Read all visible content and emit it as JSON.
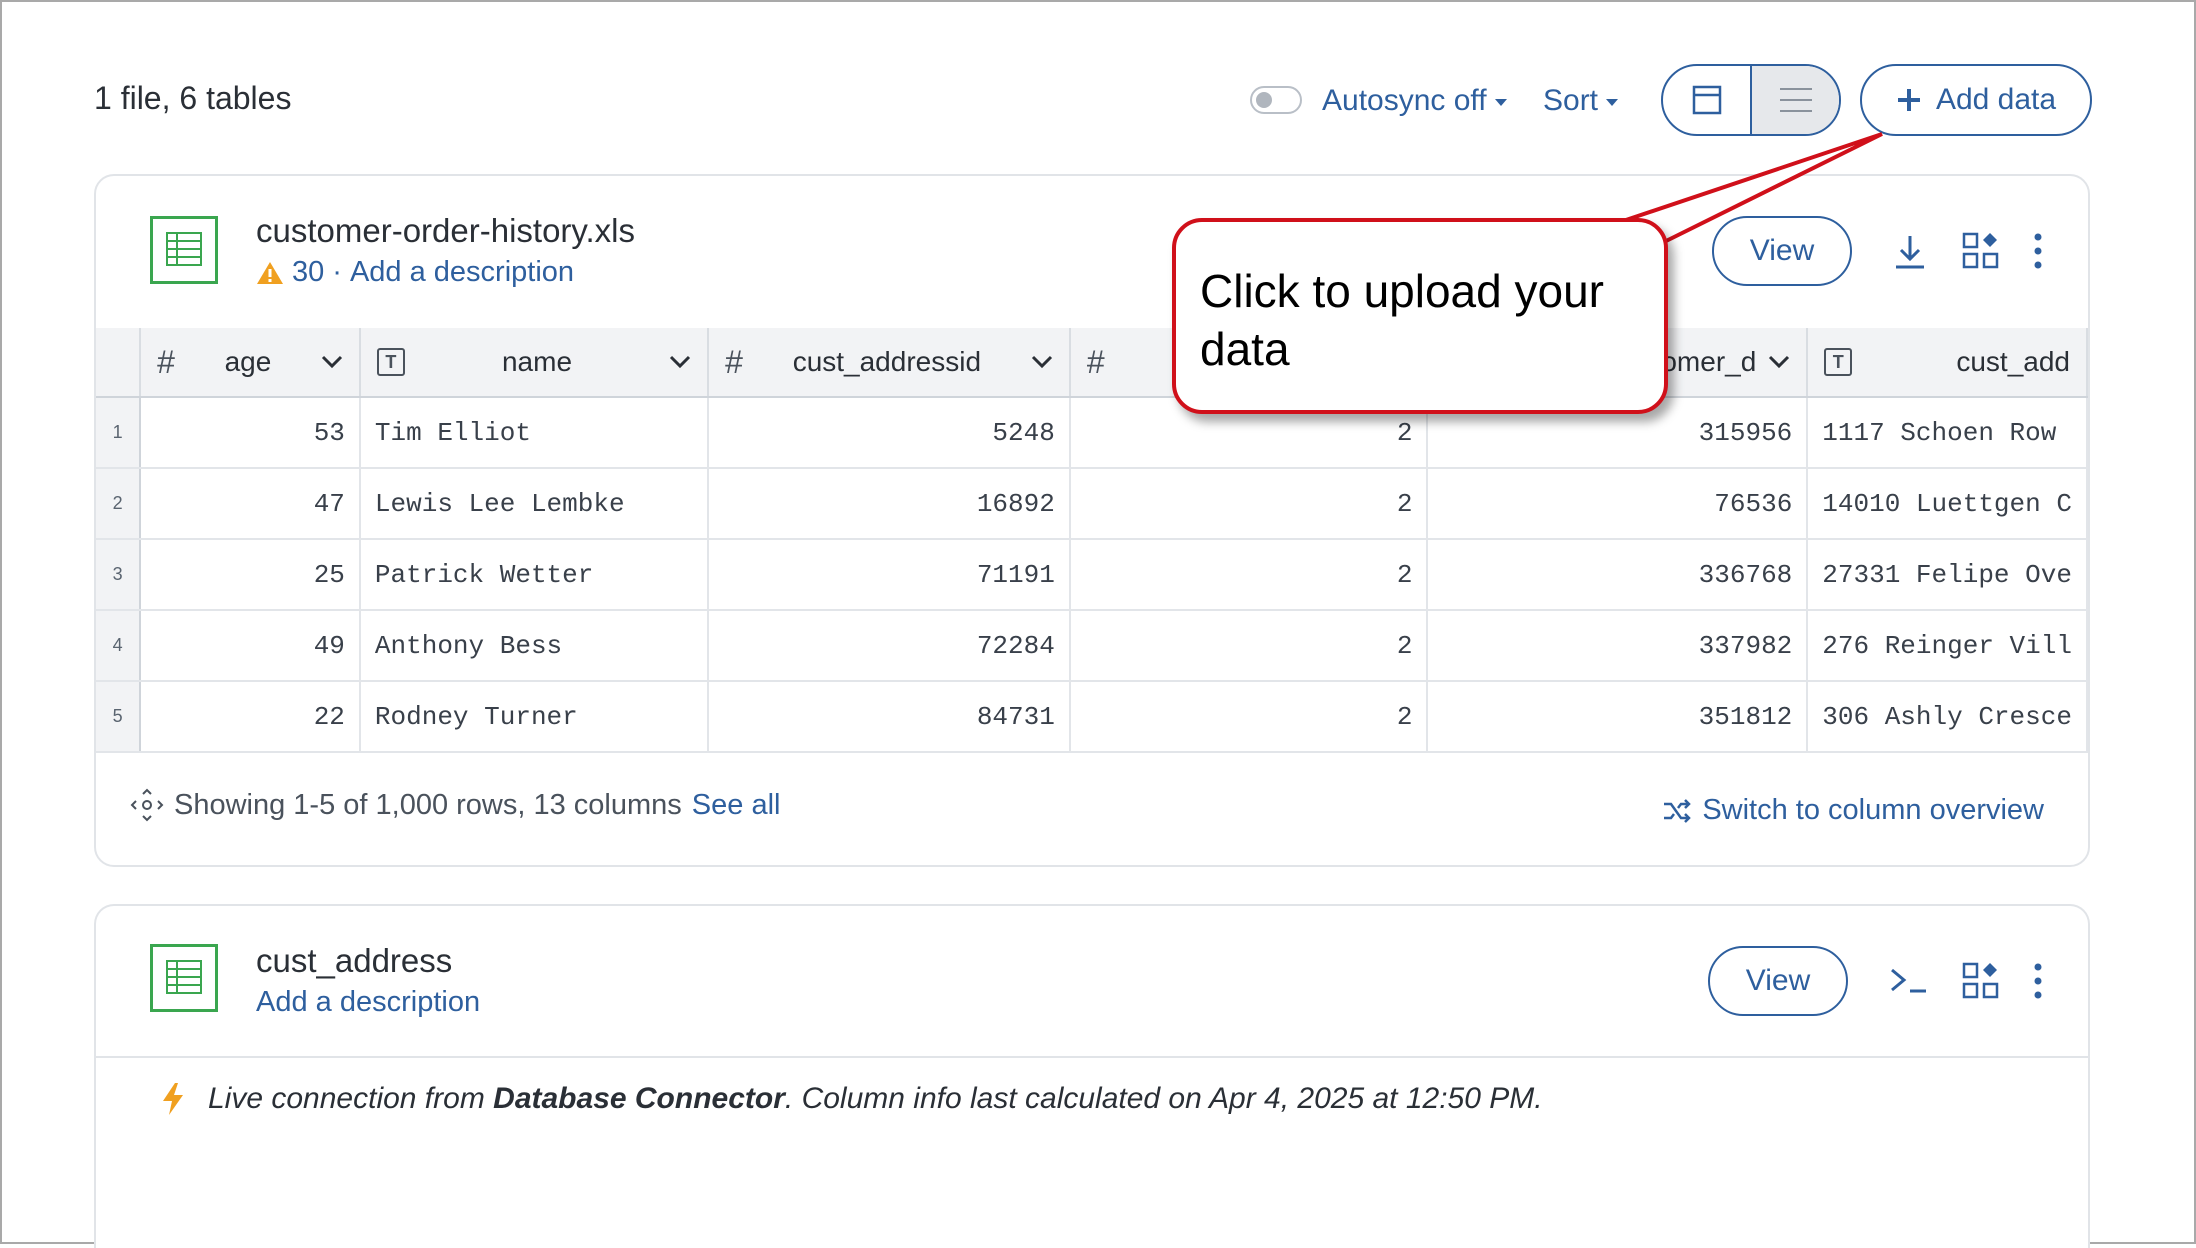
{
  "header": {
    "summary": "1 file, 6 tables",
    "autosync_label": "Autosync off",
    "sort_label": "Sort",
    "add_data_label": "Add data"
  },
  "table1": {
    "title": "customer-order-history.xls",
    "warning_count": "30",
    "separator": "·",
    "description_link": "Add a description",
    "view_label": "View",
    "columns": [
      {
        "type": "#",
        "name": "age"
      },
      {
        "type": "T",
        "name": "name"
      },
      {
        "type": "#",
        "name": "cust_addressid"
      },
      {
        "type": "#",
        "name": ""
      },
      {
        "type": "#",
        "name": "omer_d"
      },
      {
        "type": "T",
        "name": "cust_add"
      }
    ],
    "rows": [
      {
        "idx": "1",
        "age": "53",
        "name": "Tim Elliot",
        "addressid": "5248",
        "col4": "2",
        "col5": "315956",
        "address": "1117 Schoen Row"
      },
      {
        "idx": "2",
        "age": "47",
        "name": "Lewis Lee Lembke",
        "addressid": "16892",
        "col4": "2",
        "col5": "76536",
        "address": "14010 Luettgen C"
      },
      {
        "idx": "3",
        "age": "25",
        "name": "Patrick Wetter",
        "addressid": "71191",
        "col4": "2",
        "col5": "336768",
        "address": "27331 Felipe Ove"
      },
      {
        "idx": "4",
        "age": "49",
        "name": "Anthony Bess",
        "addressid": "72284",
        "col4": "2",
        "col5": "337982",
        "address": "276 Reinger Vill"
      },
      {
        "idx": "5",
        "age": "22",
        "name": "Rodney Turner",
        "addressid": "84731",
        "col4": "2",
        "col5": "351812",
        "address": "306 Ashly Cresce"
      }
    ],
    "showing_text": "Showing 1-5 of 1,000 rows, 13 columns",
    "see_all": "See all",
    "switch_label": "Switch to column overview"
  },
  "table2": {
    "title": "cust_address",
    "description_link": "Add a description",
    "view_label": "View",
    "live_prefix": "Live connection from",
    "live_source": "Database Connector",
    "live_suffix": ". Column info last calculated on Apr 4, 2025 at 12:50 PM."
  },
  "callout": {
    "line1": "Click to upload your",
    "line2": "data"
  },
  "colors": {
    "accent": "#2e5f9e",
    "sheet_green": "#3aa64f",
    "callout_red": "#d0101a",
    "warning_orange": "#f0a020"
  }
}
